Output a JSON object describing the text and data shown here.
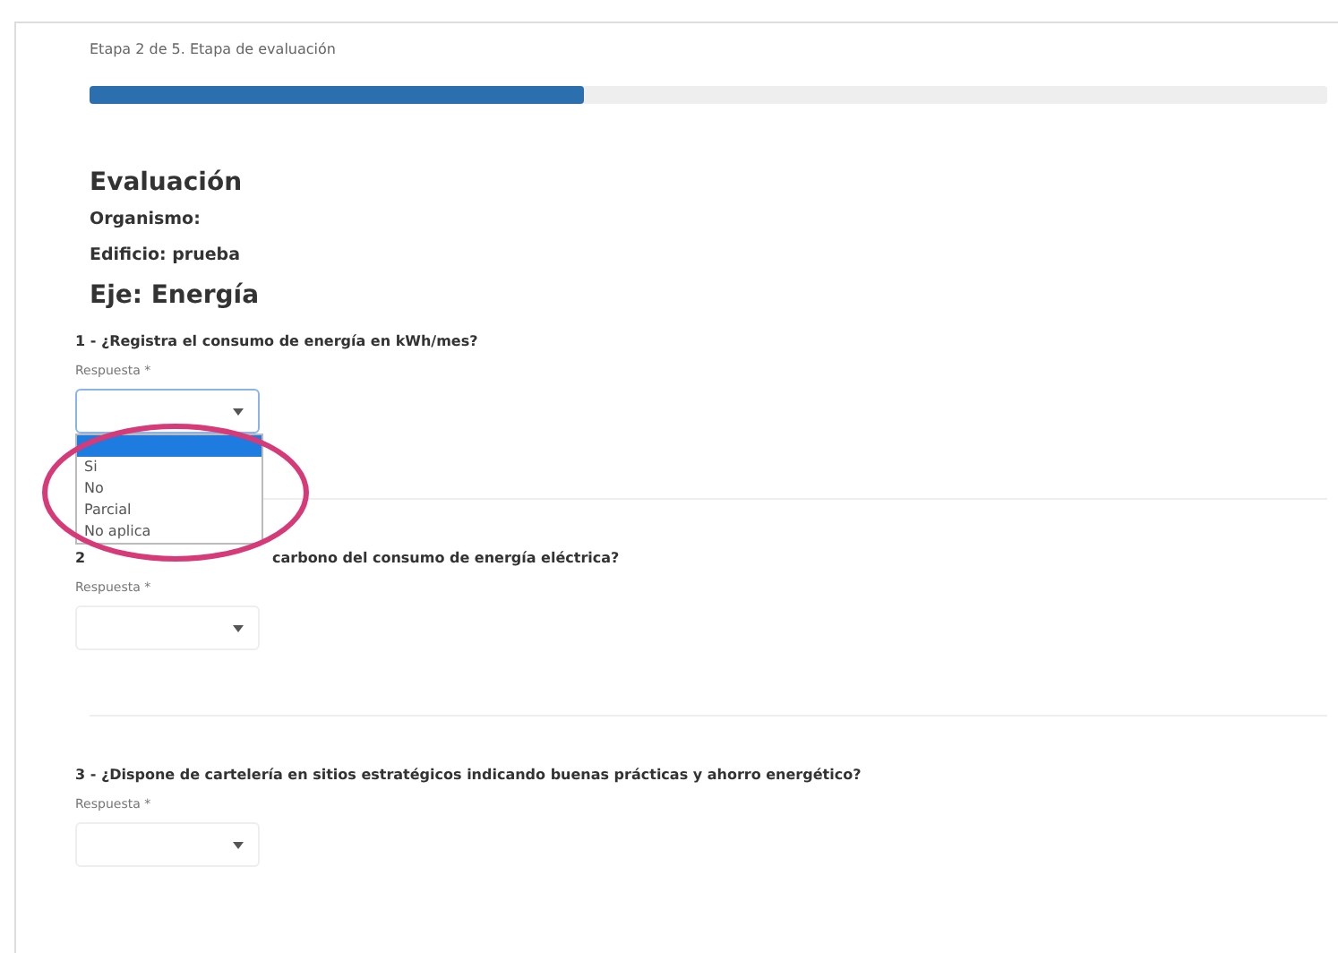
{
  "step_label": "Etapa 2 de 5. Etapa de evaluación",
  "progress": {
    "level": 0.4
  },
  "title": "Evaluación",
  "organismo": "Organismo:",
  "edificio": "Edificio: prueba",
  "axis": "Eje: Energía",
  "questions": [
    {
      "text": "1 - ¿Registra el consumo de energía en kWh/mes?",
      "label": "Respuesta *",
      "expanded": true,
      "options": [
        {
          "selected": true
        },
        {
          "label": "Si",
          "selected": false
        },
        {
          "label": "No",
          "selected": false
        },
        {
          "label": "Parcial",
          "selected": false
        },
        {
          "label": "No aplica",
          "selected": false
        }
      ]
    },
    {
      "number": "2",
      "text": "carbono del consumo de energía eléctrica?",
      "label": "Respuesta *",
      "expanded": false
    },
    {
      "text": "3 - ¿Dispone de cartelería en sitios estratégicos indicando buenas prácticas y ahorro energético?",
      "label": "Respuesta *",
      "expanded": false
    }
  ]
}
